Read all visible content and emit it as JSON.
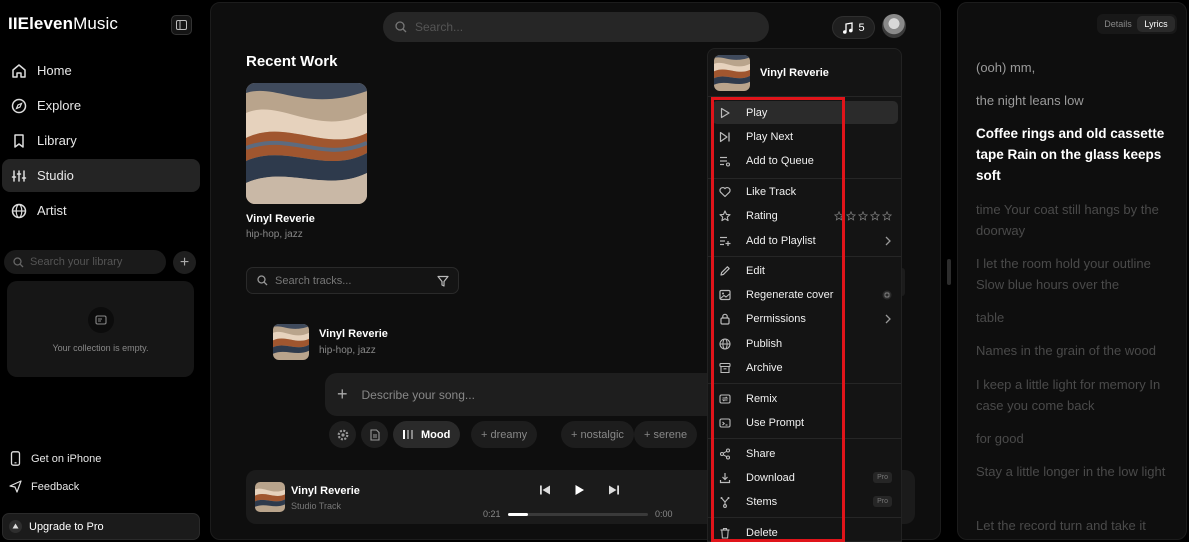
{
  "app": {
    "logo_prefix": "II",
    "logo_bold": "Eleven",
    "logo_rest": "Music"
  },
  "sidebar": {
    "nav": [
      {
        "label": "Home",
        "icon": "home-icon"
      },
      {
        "label": "Explore",
        "icon": "compass-icon"
      },
      {
        "label": "Library",
        "icon": "bookmark-icon"
      },
      {
        "label": "Studio",
        "icon": "sliders-icon",
        "active": true
      },
      {
        "label": "Artist",
        "icon": "globe-icon"
      }
    ],
    "search_placeholder": "Search your library",
    "empty_text": "Your collection is empty.",
    "get_iphone": "Get on iPhone",
    "feedback": "Feedback",
    "upgrade": "Upgrade to Pro"
  },
  "header": {
    "search_placeholder": "Search...",
    "credits": "5"
  },
  "main": {
    "recent_title": "Recent Work",
    "recent": {
      "name": "Vinyl Reverie",
      "tags": "hip-hop, jazz"
    },
    "track_search_placeholder": "Search tracks...",
    "track": {
      "name": "Vinyl Reverie",
      "tags": "hip-hop, jazz"
    },
    "prompt_placeholder": "Describe your song...",
    "chips": {
      "mood": "Mood",
      "c1": "+ dreamy",
      "c2": "+ nostalgic",
      "c3": "+ serene"
    }
  },
  "player": {
    "title": "Vinyl Reverie",
    "subtitle": "Studio Track",
    "elapsed": "0:21",
    "total": "0:00",
    "progress": 0.14
  },
  "menu": {
    "title": "Vinyl Reverie",
    "items": [
      {
        "label": "Play",
        "icon": "play-icon"
      },
      {
        "label": "Play Next",
        "icon": "skip-next-icon"
      },
      {
        "label": "Add to Queue",
        "icon": "queue-icon"
      },
      {
        "label": "Like Track",
        "icon": "heart-icon"
      },
      {
        "label": "Rating",
        "icon": "star-icon",
        "rating": 0,
        "max": 5
      },
      {
        "label": "Add to Playlist",
        "icon": "playlist-add-icon"
      },
      {
        "label": "Edit",
        "icon": "pencil-icon"
      },
      {
        "label": "Regenerate cover",
        "icon": "image-icon"
      },
      {
        "label": "Permissions",
        "icon": "lock-icon"
      },
      {
        "label": "Publish",
        "icon": "globe-icon"
      },
      {
        "label": "Archive",
        "icon": "archive-icon"
      },
      {
        "label": "Remix",
        "icon": "remix-icon"
      },
      {
        "label": "Use Prompt",
        "icon": "prompt-icon"
      },
      {
        "label": "Share",
        "icon": "share-icon"
      },
      {
        "label": "Download",
        "icon": "download-icon",
        "badge": "Pro"
      },
      {
        "label": "Stems",
        "icon": "stems-icon",
        "badge": "Pro"
      },
      {
        "label": "Delete",
        "icon": "trash-icon"
      }
    ]
  },
  "lyrics_panel": {
    "tabs": [
      "Details",
      "Lyrics"
    ],
    "active_tab": "Lyrics",
    "lines": [
      "(ooh) mm,",
      "the night leans low",
      "Coffee rings and old cassette tape Rain on the glass keeps soft",
      "time Your coat still hangs by the doorway",
      "I let the room hold your outline Slow blue hours over the",
      "table",
      "Names in the grain of the wood",
      "I keep a little light for memory In case you come back",
      "for good",
      "Stay a little longer in the low light",
      "Let the record turn and take it"
    ]
  },
  "colors": {
    "highlight": "#e0141a",
    "accent_bg": "#242424"
  }
}
